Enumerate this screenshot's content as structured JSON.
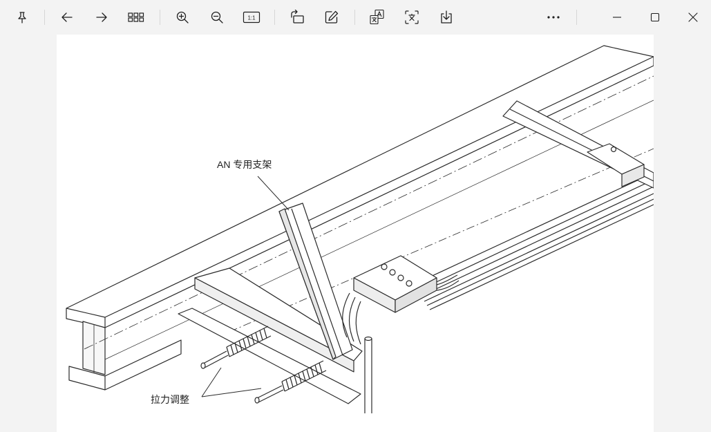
{
  "colors": {
    "toolbar_bg": "#f3f3f3",
    "icon": "#1f1f1f",
    "canvas": "#ffffff",
    "ink": "#2a2a2a"
  },
  "toolbar": {
    "icons": [
      "pin-icon",
      "arrow-left-icon",
      "arrow-right-icon",
      "grid-icon",
      "zoom-in-icon",
      "zoom-out-icon",
      "actual-size-icon",
      "rotate-icon",
      "edit-icon",
      "translate-icon",
      "ocr-icon",
      "save-icon",
      "more-icon",
      "minimize-icon",
      "maximize-icon",
      "close-icon"
    ],
    "actual_size_label": "1:1"
  },
  "drawing": {
    "label_bracket": "AN 专用支架",
    "label_tension": "拉力调整"
  }
}
